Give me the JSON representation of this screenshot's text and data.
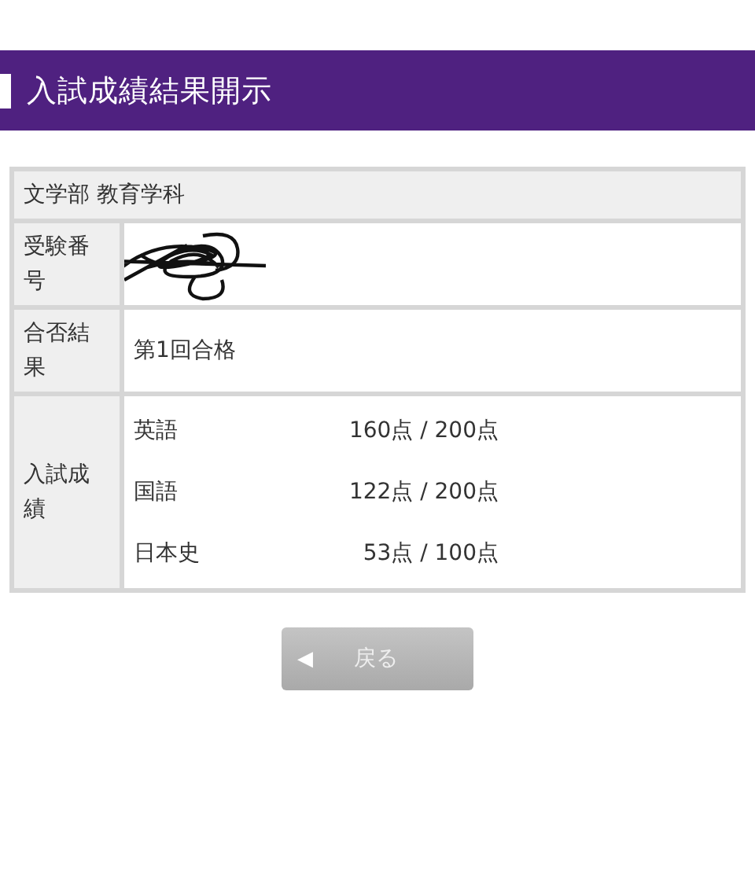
{
  "header": {
    "title": "入試成績結果開示"
  },
  "result": {
    "department": "文学部 教育学科",
    "rows": [
      {
        "kind": "redacted",
        "label": "受験番号"
      },
      {
        "kind": "text",
        "label": "合否結果",
        "value": "第1回合格"
      },
      {
        "kind": "scores",
        "label": "入試成績",
        "scores": [
          {
            "subject": "英語",
            "score": "160点 / 200点"
          },
          {
            "subject": "国語",
            "score": "122点 / 200点"
          },
          {
            "subject": "日本史",
            "score": "53点 / 100点"
          }
        ]
      }
    ]
  },
  "back_button": {
    "icon": "◀",
    "label": "戻る"
  }
}
